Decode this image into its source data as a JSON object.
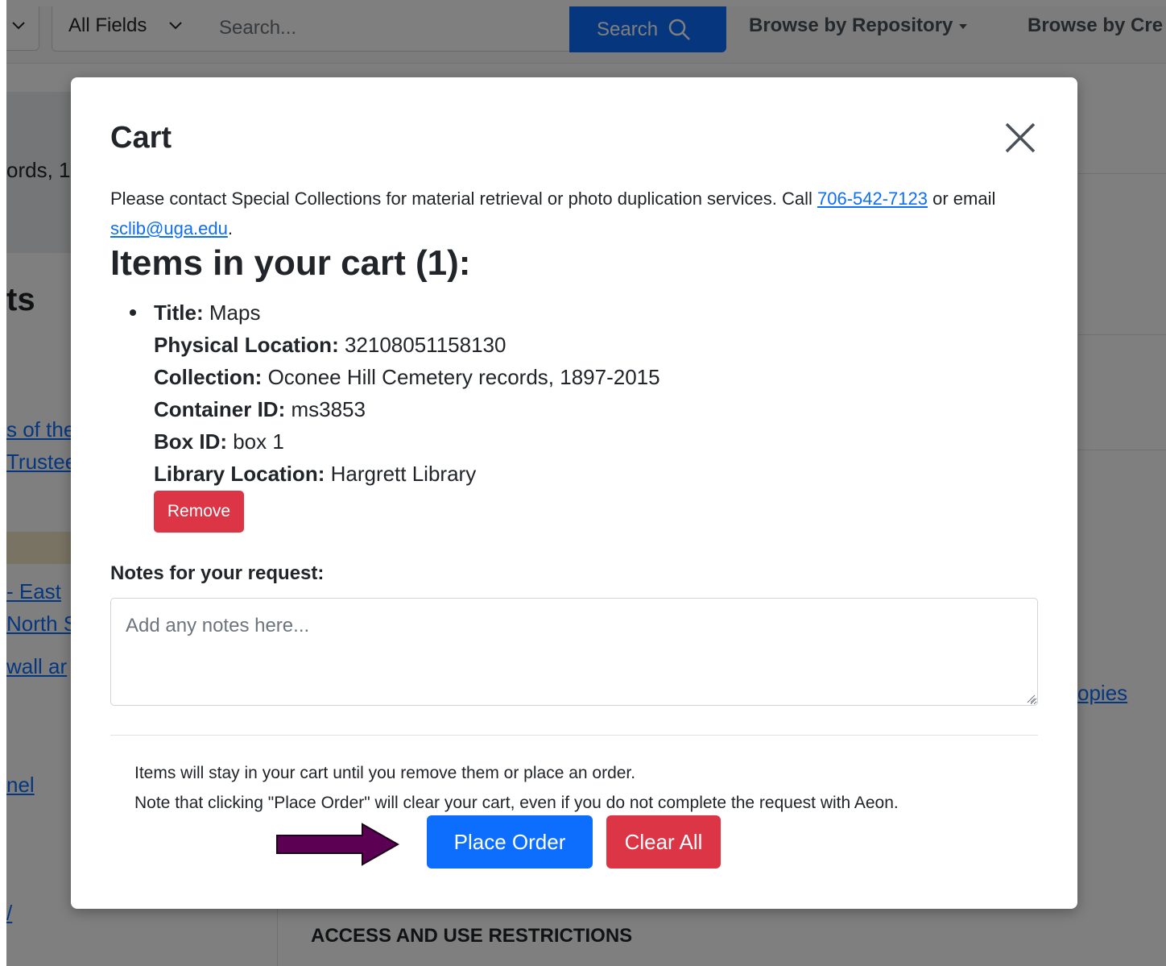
{
  "header": {
    "fields_label": "All Fields",
    "search_placeholder": "Search...",
    "search_button": "Search",
    "nav_repository": "Browse by Repository",
    "nav_creator": "Browse by Cre"
  },
  "background": {
    "frag_records": "ords, 1",
    "frag_ts": "ts",
    "link_of_the": "s of the",
    "link_trustee": "Trustee",
    "link_east": "- East",
    "link_north": "North S",
    "link_wall": "wall ar",
    "link_nel": "nel",
    "link_copies": "opies",
    "link_slash": "/",
    "access_heading": "ACCESS AND USE RESTRICTIONS"
  },
  "modal": {
    "title": "Cart",
    "intro_text": "Please contact Special Collections for material retrieval or photo duplication services. Call ",
    "phone": "706-542-7123",
    "intro_or": " or email ",
    "email": "sclib@uga.edu",
    "intro_end": ".",
    "items_heading": "Items in your cart (1):",
    "item": {
      "title_label": "Title:",
      "title_value": " Maps",
      "location_label": "Physical Location:",
      "location_value": " 32108051158130",
      "collection_label": "Collection:",
      "collection_value": " Oconee Hill Cemetery records, 1897-2015",
      "container_label": "Container ID:",
      "container_value": " ms3853",
      "box_label": "Box ID:",
      "box_value": " box 1",
      "library_label": "Library Location:",
      "library_value": " Hargrett Library"
    },
    "remove_button": "Remove",
    "notes_label": "Notes for your request:",
    "notes_placeholder": "Add any notes here...",
    "footer_line1": "Items will stay in your cart until you remove them or place an order.",
    "footer_line2": "Note that clicking \"Place Order\" will clear your cart, even if you do not complete the request with Aeon.",
    "place_order_button": "Place Order",
    "clear_all_button": "Clear All"
  },
  "colors": {
    "primary": "#0d6efd",
    "danger": "#dc3545",
    "arrow": "#5c0054"
  }
}
